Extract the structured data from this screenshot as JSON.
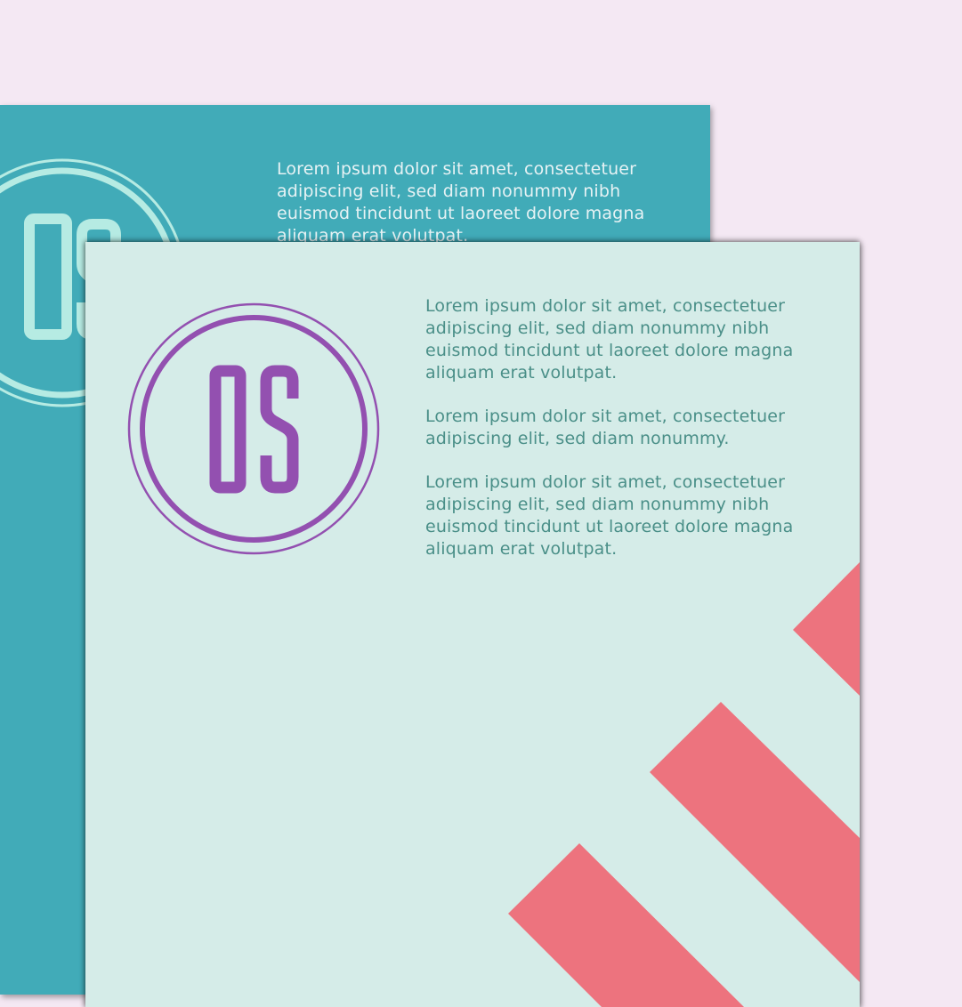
{
  "colors": {
    "background": "#f4e8f3",
    "back_sheet": "#41abb8",
    "front_sheet": "#d5ece8",
    "back_logo": "#b6ebe3",
    "front_logo": "#9350b0",
    "back_text": "#e6f2f4",
    "front_text": "#4a8f88",
    "stripe": "#ed737e"
  },
  "back_sheet": {
    "logo_text": "OS",
    "paragraphs": [
      "Lorem ipsum dolor sit amet, consectetuer\nadipiscing elit, sed diam nonummy nibh\neuismod tincidunt ut laoreet dolore magna\naliquam erat volutpat."
    ]
  },
  "front_sheet": {
    "logo_text": "OS",
    "paragraphs": [
      "Lorem ipsum dolor sit amet, consectetuer\nadipiscing elit, sed diam nonummy nibh\neuismod tincidunt ut laoreet dolore magna\naliquam erat volutpat.",
      "Lorem ipsum dolor sit amet, consectetuer\nadipiscing elit, sed diam nonummy.",
      "Lorem ipsum dolor sit amet, consectetuer\nadipiscing elit, sed diam nonummy nibh\neuismod tincidunt ut laoreet dolore magna\naliquam erat volutpat."
    ]
  }
}
